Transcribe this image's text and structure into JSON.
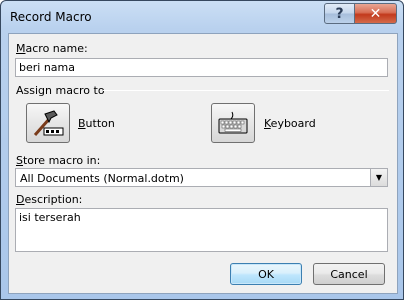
{
  "window": {
    "title": "Record Macro",
    "help_glyph": "?",
    "close_glyph": "✕"
  },
  "form": {
    "macro_name_label": "Macro name:",
    "macro_name_value": "beri nama",
    "assign_label": "Assign macro to",
    "button_label": "Button",
    "keyboard_label": "Keyboard",
    "store_label": "Store macro in:",
    "store_value": "All Documents (Normal.dotm)",
    "description_label": "Description:",
    "description_value": "isi terserah"
  },
  "actions": {
    "ok_label": "OK",
    "cancel_label": "Cancel"
  },
  "icons": {
    "help": "help-icon",
    "close": "close-icon",
    "button_tool": "toolbar-button-icon",
    "keyboard": "keyboard-icon",
    "dropdown": "chevron-down-icon"
  }
}
